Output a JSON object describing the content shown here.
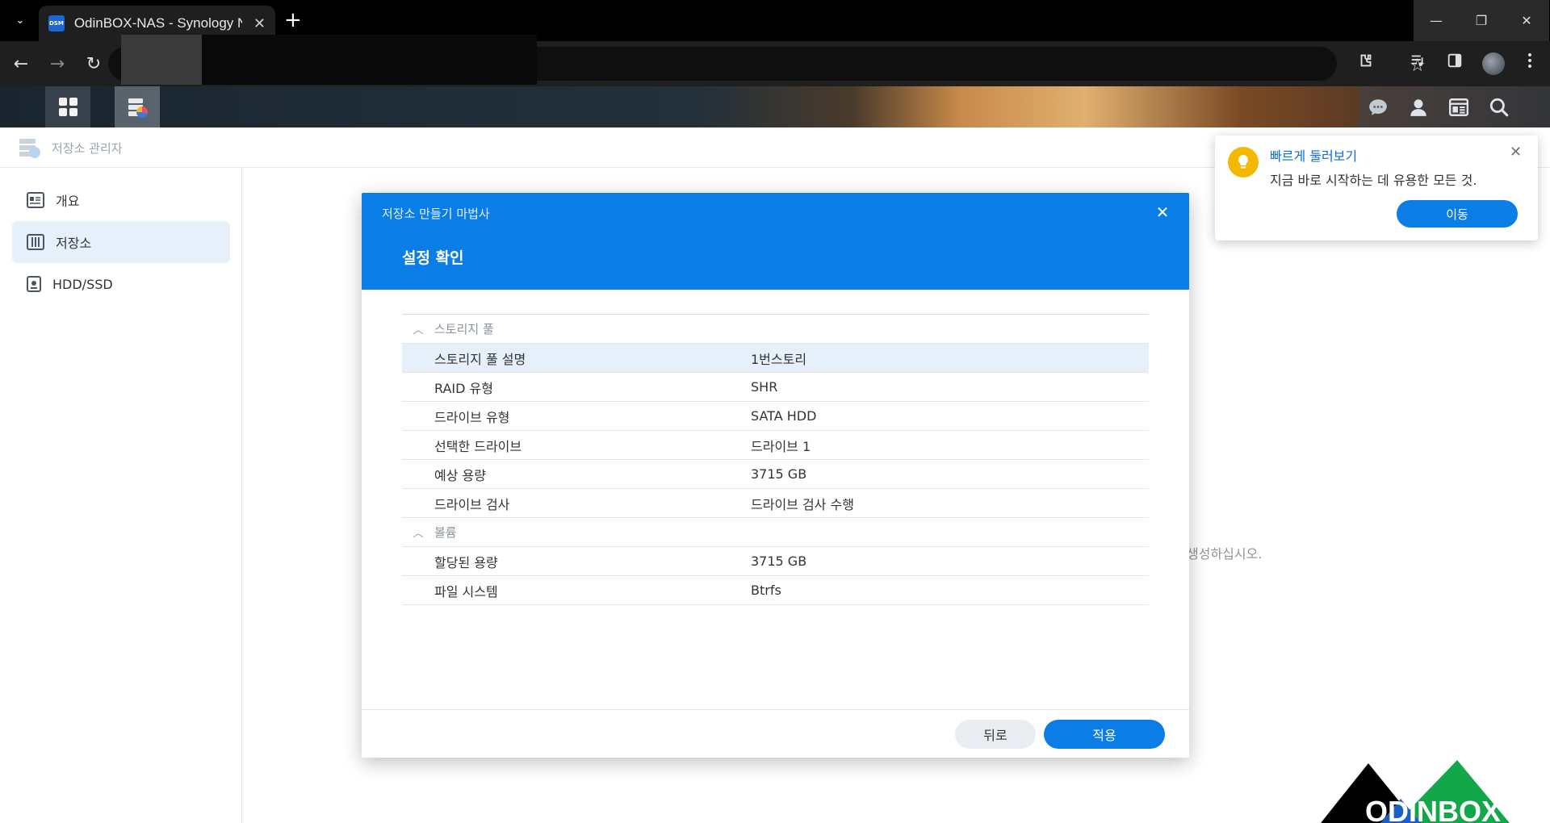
{
  "browser": {
    "tab_title": "OdinBOX-NAS - Synology NAS",
    "favicon_text": "DSM",
    "tab_menu_glyph": "⌄",
    "tab_close_glyph": "✕",
    "new_tab_glyph": "+",
    "win_min": "—",
    "win_max": "❐",
    "win_close": "✕",
    "back": "←",
    "forward": "→",
    "reload": "↻",
    "star": "☆"
  },
  "app": {
    "title": "저장소 관리자"
  },
  "sidebar": {
    "items": [
      {
        "label": "개요"
      },
      {
        "label": "저장소"
      },
      {
        "label": "HDD/SSD"
      }
    ]
  },
  "main": {
    "hint": "생성하십시오."
  },
  "modal": {
    "wizard_title": "저장소 만들기 마법사",
    "step_title": "설정 확인",
    "close": "✕",
    "sections": [
      {
        "title": "스토리지 풀",
        "rows": [
          {
            "key": "스토리지 풀 설명",
            "value": "1번스토리"
          },
          {
            "key": "RAID 유형",
            "value": "SHR"
          },
          {
            "key": "드라이브 유형",
            "value": "SATA HDD"
          },
          {
            "key": "선택한 드라이브",
            "value": "드라이브 1"
          },
          {
            "key": "예상 용량",
            "value": "3715 GB"
          },
          {
            "key": "드라이브 검사",
            "value": "드라이브 검사 수행"
          }
        ]
      },
      {
        "title": "볼륨",
        "rows": [
          {
            "key": "할당된 용량",
            "value": "3715 GB"
          },
          {
            "key": "파일 시스템",
            "value": "Btrfs"
          }
        ]
      }
    ],
    "back_label": "뒤로",
    "apply_label": "적용"
  },
  "tour": {
    "title": "빠르게 둘러보기",
    "desc": "지금 바로 시작하는 데 유용한 모든 것.",
    "button": "이동",
    "close": "✕"
  },
  "watermark": {
    "text": "ODINBOX"
  },
  "colors": {
    "accent": "#0a7ee6",
    "highlight": "#e6f0fb",
    "bulb": "#f5b800"
  }
}
